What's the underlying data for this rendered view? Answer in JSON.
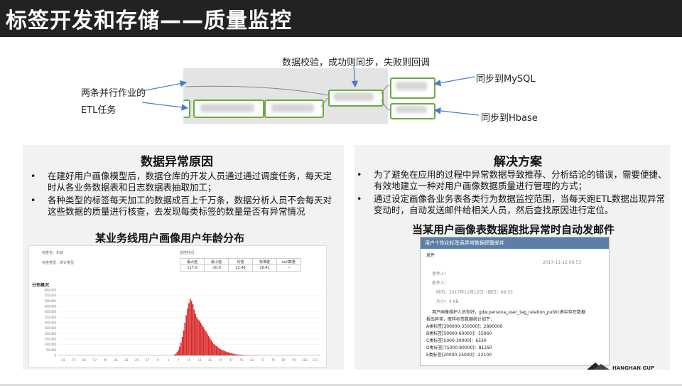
{
  "title": "标签开发和存储——质量监控",
  "flow": {
    "top_label": "数据校验，成功则同步，失败则回调",
    "left_label_1": "两条并行作业的",
    "left_label_2": "ETL任务",
    "right_label_1": "同步到MySQL",
    "right_label_2": "同步到Hbase"
  },
  "left_panel": {
    "heading": "数据异常原因",
    "bullets": [
      "在建好用户画像模型后，数据仓库的开发人员通过通过调度任务，每天定时从各业务数据表和日志数据表抽取加工；",
      "各种类型的标签每天加工的数据成百上千万条，数据分析人员不会每天对这些数据的质量进行核查，去发现每类标签的数量是否有异常情况"
    ],
    "chart_title": "某业务线用户画像用户年龄分布"
  },
  "right_panel": {
    "heading": "解决方案",
    "bullets": [
      "为了避免在应用的过程中异常数据导致推荐、分析结论的错误，需要便捷、有效地建立一种对用户画像数据质量进行管理的方式；",
      "通过设定画像各业务表各类行为数据监控范围，当每天跑ETL数据出现异常变动时，自动发送邮件给相关人员，然后查找原因进行定位。"
    ],
    "mail_title": "当某用户画像表数据跑批异常时自动发邮件"
  },
  "chart_data": {
    "type": "bar",
    "title": "",
    "top_labels": [
      "标签名：年龄",
      "标签类型：统计类型",
      "监控时间："
    ],
    "section_label": "分布概况",
    "stats_headers": [
      "最大值",
      "最小值",
      "均值",
      "标准差",
      "null数量"
    ],
    "stats_values": [
      "117.0",
      "-10.0",
      "21.48",
      "16.41",
      "--"
    ],
    "ylim": [
      0,
      600000
    ],
    "yticks": [
      "600,000",
      "550,000",
      "500,000",
      "450,000",
      "400,000",
      "350,000",
      "300,000",
      "250,000",
      "200,000",
      "150,000",
      "100,000",
      "50,000",
      "0"
    ],
    "xticks": [
      "-81",
      "-73",
      "-65",
      "-57",
      "-49",
      "-41",
      "-33",
      "-25",
      "-17",
      "-9",
      "-1",
      "7",
      "15",
      "23",
      "31",
      "39",
      "47",
      "55",
      "63",
      "71",
      "79",
      "87",
      "95",
      "103",
      "111"
    ],
    "color": "#d92b2b",
    "x": [
      4,
      5,
      6,
      7,
      8,
      9,
      10,
      11,
      12,
      13,
      14,
      15,
      16,
      17,
      18,
      19,
      20,
      21,
      22,
      23,
      24,
      25,
      26,
      27,
      28,
      29,
      30,
      31,
      32,
      33,
      34,
      35,
      36,
      37,
      38,
      39,
      40,
      41,
      42,
      43,
      44,
      45,
      46,
      47,
      48,
      49,
      50,
      51,
      52,
      53,
      54,
      55,
      56,
      57,
      58,
      59,
      60,
      61,
      62,
      63,
      64,
      65,
      66,
      67,
      68,
      69,
      70
    ],
    "values": [
      8000,
      15000,
      30000,
      50000,
      80000,
      120000,
      170000,
      230000,
      300000,
      370000,
      430000,
      480000,
      520000,
      500000,
      470000,
      420000,
      380000,
      350000,
      330000,
      320000,
      300000,
      280000,
      260000,
      240000,
      220000,
      200000,
      180000,
      160000,
      140000,
      120000,
      105000,
      95000,
      85000,
      75000,
      65000,
      58000,
      52000,
      47000,
      42000,
      37000,
      32000,
      28000,
      24000,
      21000,
      18000,
      15000,
      12000,
      10000,
      8500,
      7000,
      6000,
      5000,
      4200,
      3500,
      3000,
      2500,
      2000,
      1700,
      1400,
      1200,
      1000,
      800,
      700,
      600,
      500,
      400,
      300
    ]
  },
  "mail": {
    "header": "用户个性化标签表异常数据预警邮件",
    "subject": "发件",
    "from_label": "发件人：",
    "to_label": "收件人：",
    "time": "时间：2017年11月12日（周日）09:53",
    "size": "大小：4 KB",
    "date_right": "2017-11-12 09:53",
    "greeting": "用户画像维护人员你好，gdw.persona_user_tag_relation_public表中存在数据",
    "line2": "报出异常，取样标签数据统计如下：",
    "rows": [
      "A类标签[300000-350000]：2890000",
      "B类标签[50000-60000]：55060",
      "C类标签[5000-30000]：6530",
      "D类标签[75000-80000]：81250",
      "E类标签[20000-25000]：22100"
    ]
  },
  "footer": {
    "logo_text": "HANGHAN GUP"
  }
}
